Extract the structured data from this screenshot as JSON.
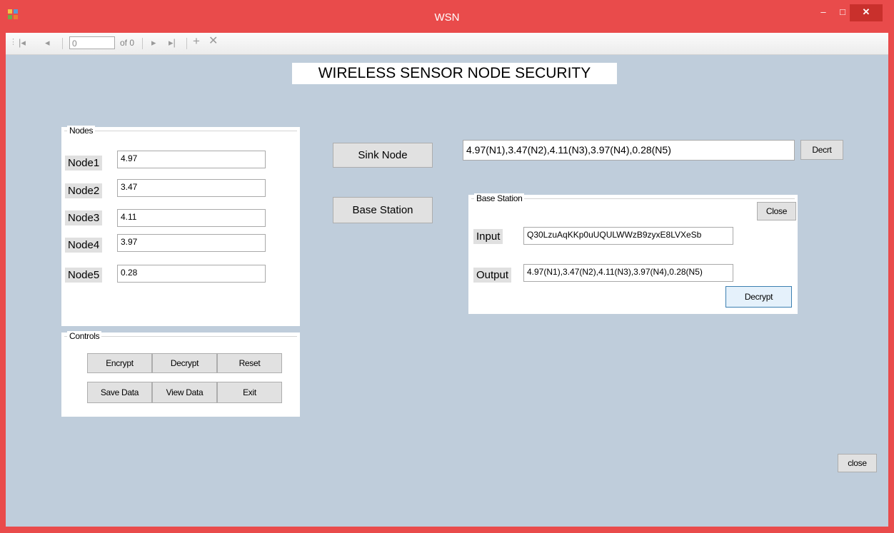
{
  "window": {
    "title": "WSN",
    "minimize_glyph": "–",
    "maximize_glyph": "□",
    "close_glyph": "✕"
  },
  "navigator": {
    "position_value": "0",
    "count_text": "of 0"
  },
  "heading": "WIRELESS SENSOR NODE SECURITY",
  "nodes_group": {
    "title": "Nodes",
    "items": [
      {
        "label": "Node1",
        "value": "4.97"
      },
      {
        "label": "Node2",
        "value": "3.47"
      },
      {
        "label": "Node3",
        "value": "4.11"
      },
      {
        "label": "Node4",
        "value": "3.97"
      },
      {
        "label": "Node5",
        "value": "0.28"
      }
    ]
  },
  "controls_group": {
    "title": "Controls",
    "encrypt": "Encrypt",
    "decrypt": "Decrypt",
    "reset": "Reset",
    "save": "Save Data",
    "view": "View Data",
    "exit": "Exit"
  },
  "sink_node_button": "Sink Node",
  "base_station_button": "Base Station",
  "sink_output": "4.97(N1),3.47(N2),4.11(N3),3.97(N4),0.28(N5)",
  "decrt_button": "Decrt",
  "base_station_group": {
    "title": "Base Station",
    "close_button": "Close",
    "input_label": "Input",
    "input_value": "Q30LzuAqKKp0uUQULWWzB9zyxE8LVXeSb",
    "output_label": "Output",
    "output_value": "4.97(N1),3.47(N2),4.11(N3),3.97(N4),0.28(N5)",
    "decrypt_button": "Decrypt"
  },
  "bottom_close_button": "close",
  "colors": {
    "title_bar": "#e94b4b",
    "client_bg": "#bfcddb"
  }
}
